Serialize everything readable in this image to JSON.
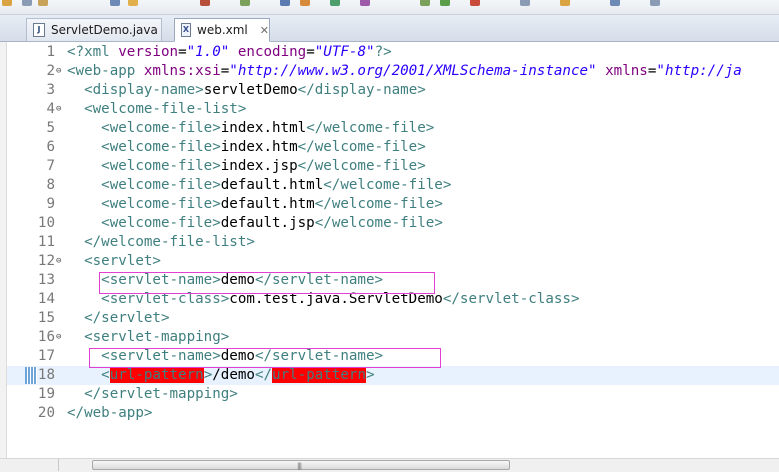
{
  "tabs": [
    {
      "label": "ServletDemo.java",
      "icon": "java-file-icon",
      "active": false
    },
    {
      "label": "web.xml",
      "icon": "xml-file-icon",
      "active": true,
      "close": "✕"
    }
  ],
  "colors": {
    "tag": "#3f7f7f",
    "attribute": "#7f007f",
    "attribute_value": "#2a00ff",
    "error_highlight": "#ff0000",
    "annotation_box": "#e23fd3",
    "current_line": "#e8f2fe"
  },
  "editor": {
    "current_line": 18,
    "lines": [
      {
        "n": "1",
        "fold": "",
        "tokens": [
          {
            "c": "pi",
            "t": "<?"
          },
          {
            "c": "tag",
            "t": "xml "
          },
          {
            "c": "attr",
            "t": "version"
          },
          {
            "c": "txt",
            "t": "="
          },
          {
            "c": "val",
            "t": "\"1.0\""
          },
          {
            "c": "txt",
            "t": " "
          },
          {
            "c": "attr",
            "t": "encoding"
          },
          {
            "c": "txt",
            "t": "="
          },
          {
            "c": "val",
            "t": "\"UTF-8\""
          },
          {
            "c": "pi",
            "t": "?>"
          }
        ]
      },
      {
        "n": "2",
        "fold": "⊖",
        "tokens": [
          {
            "c": "tag",
            "t": "<web-app "
          },
          {
            "c": "attr",
            "t": "xmlns:xsi"
          },
          {
            "c": "txt",
            "t": "="
          },
          {
            "c": "val",
            "t": "\"http://www.w3.org/2001/XMLSchema-instance\""
          },
          {
            "c": "txt",
            "t": " "
          },
          {
            "c": "attr",
            "t": "xmlns"
          },
          {
            "c": "txt",
            "t": "="
          },
          {
            "c": "val",
            "t": "\"http://ja"
          }
        ]
      },
      {
        "n": "3",
        "fold": "",
        "tokens": [
          {
            "c": "txt",
            "t": "  "
          },
          {
            "c": "tag",
            "t": "<display-name>"
          },
          {
            "c": "txt",
            "t": "servletDemo"
          },
          {
            "c": "tag",
            "t": "</display-name>"
          }
        ]
      },
      {
        "n": "4",
        "fold": "⊖",
        "tokens": [
          {
            "c": "txt",
            "t": "  "
          },
          {
            "c": "tag",
            "t": "<welcome-file-list>"
          }
        ]
      },
      {
        "n": "5",
        "fold": "",
        "tokens": [
          {
            "c": "txt",
            "t": "    "
          },
          {
            "c": "tag",
            "t": "<welcome-file>"
          },
          {
            "c": "txt",
            "t": "index.html"
          },
          {
            "c": "tag",
            "t": "</welcome-file>"
          }
        ]
      },
      {
        "n": "6",
        "fold": "",
        "tokens": [
          {
            "c": "txt",
            "t": "    "
          },
          {
            "c": "tag",
            "t": "<welcome-file>"
          },
          {
            "c": "txt",
            "t": "index.htm"
          },
          {
            "c": "tag",
            "t": "</welcome-file>"
          }
        ]
      },
      {
        "n": "7",
        "fold": "",
        "tokens": [
          {
            "c": "txt",
            "t": "    "
          },
          {
            "c": "tag",
            "t": "<welcome-file>"
          },
          {
            "c": "txt",
            "t": "index.jsp"
          },
          {
            "c": "tag",
            "t": "</welcome-file>"
          }
        ]
      },
      {
        "n": "8",
        "fold": "",
        "tokens": [
          {
            "c": "txt",
            "t": "    "
          },
          {
            "c": "tag",
            "t": "<welcome-file>"
          },
          {
            "c": "txt",
            "t": "default.html"
          },
          {
            "c": "tag",
            "t": "</welcome-file>"
          }
        ]
      },
      {
        "n": "9",
        "fold": "",
        "tokens": [
          {
            "c": "txt",
            "t": "    "
          },
          {
            "c": "tag",
            "t": "<welcome-file>"
          },
          {
            "c": "txt",
            "t": "default.htm"
          },
          {
            "c": "tag",
            "t": "</welcome-file>"
          }
        ]
      },
      {
        "n": "10",
        "fold": "",
        "tokens": [
          {
            "c": "txt",
            "t": "    "
          },
          {
            "c": "tag",
            "t": "<welcome-file>"
          },
          {
            "c": "txt",
            "t": "default.jsp"
          },
          {
            "c": "tag",
            "t": "</welcome-file>"
          }
        ]
      },
      {
        "n": "11",
        "fold": "",
        "tokens": [
          {
            "c": "txt",
            "t": "  "
          },
          {
            "c": "tag",
            "t": "</welcome-file-list>"
          }
        ]
      },
      {
        "n": "12",
        "fold": "⊖",
        "tokens": [
          {
            "c": "txt",
            "t": "  "
          },
          {
            "c": "tag",
            "t": "<servlet>"
          }
        ]
      },
      {
        "n": "13",
        "fold": "",
        "tokens": [
          {
            "c": "txt",
            "t": "    "
          },
          {
            "c": "tag",
            "t": "<servlet-name>"
          },
          {
            "c": "txt",
            "t": "demo"
          },
          {
            "c": "tag",
            "t": "</servlet-name>"
          }
        ]
      },
      {
        "n": "14",
        "fold": "",
        "tokens": [
          {
            "c": "txt",
            "t": "    "
          },
          {
            "c": "tag",
            "t": "<servlet-class>"
          },
          {
            "c": "txt",
            "t": "com.test.java.ServletDemo"
          },
          {
            "c": "tag",
            "t": "</servlet-class>"
          }
        ]
      },
      {
        "n": "15",
        "fold": "",
        "tokens": [
          {
            "c": "txt",
            "t": "  "
          },
          {
            "c": "tag",
            "t": "</servlet>"
          }
        ]
      },
      {
        "n": "16",
        "fold": "⊖",
        "tokens": [
          {
            "c": "txt",
            "t": "  "
          },
          {
            "c": "tag",
            "t": "<servlet-mapping>"
          }
        ]
      },
      {
        "n": "17",
        "fold": "",
        "tokens": [
          {
            "c": "txt",
            "t": "    "
          },
          {
            "c": "tag",
            "t": "<servlet-name>"
          },
          {
            "c": "txt",
            "t": "demo"
          },
          {
            "c": "tag",
            "t": "</servlet-name>"
          }
        ]
      },
      {
        "n": "18",
        "fold": "",
        "tokens": [
          {
            "c": "txt",
            "t": "    "
          },
          {
            "c": "tag",
            "t": "<"
          },
          {
            "c": "err",
            "t": "url-pattern"
          },
          {
            "c": "tag",
            "t": ">"
          },
          {
            "c": "txt",
            "t": "/demo"
          },
          {
            "c": "tag",
            "t": "</"
          },
          {
            "c": "err",
            "t": "url-pattern"
          },
          {
            "c": "tag",
            "t": ">"
          }
        ]
      },
      {
        "n": "19",
        "fold": "",
        "tokens": [
          {
            "c": "txt",
            "t": "  "
          },
          {
            "c": "tag",
            "t": "</servlet-mapping>"
          }
        ]
      },
      {
        "n": "20",
        "fold": "",
        "tokens": [
          {
            "c": "tag",
            "t": "</web-app>"
          }
        ]
      }
    ]
  },
  "annotations": [
    {
      "line": 13,
      "label": "servlet-name demo"
    },
    {
      "line": 17,
      "label": "servlet-name demo"
    }
  ],
  "scrollbar": {
    "grip": "|||"
  }
}
